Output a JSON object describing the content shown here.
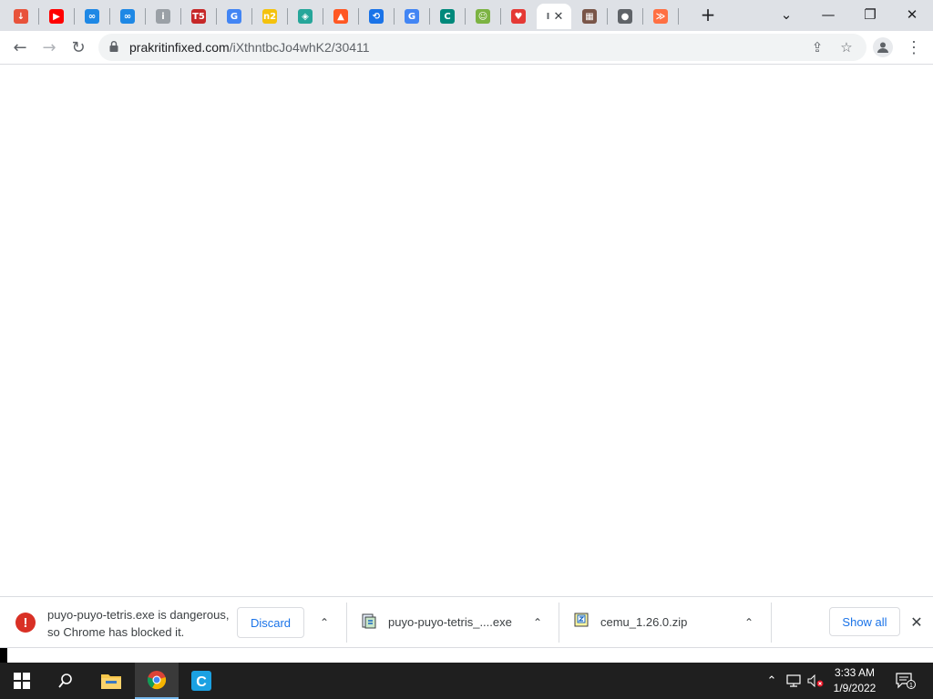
{
  "browser": {
    "tabs": [
      {
        "name": "download-tab",
        "icon": "download-icon",
        "color": "#e8533b",
        "glyph": "↓"
      },
      {
        "name": "youtube-tab",
        "icon": "youtube-icon",
        "color": "#ff0000",
        "glyph": "▶"
      },
      {
        "name": "link-tab-1",
        "icon": "link-icon",
        "color": "#1e88e5",
        "glyph": "∞"
      },
      {
        "name": "link-tab-2",
        "icon": "link-icon",
        "color": "#1e88e5",
        "glyph": "∞"
      },
      {
        "name": "info-tab",
        "icon": "info-icon",
        "color": "#9aa0a6",
        "glyph": "i"
      },
      {
        "name": "t5-tab",
        "icon": "t5-icon",
        "color": "#c62828",
        "glyph": "T5"
      },
      {
        "name": "google-tab-1",
        "icon": "google-icon",
        "color": "#4285f4",
        "glyph": "G"
      },
      {
        "name": "n2-tab",
        "icon": "n2-icon",
        "color": "#f4c20d",
        "glyph": "n2"
      },
      {
        "name": "cube-tab",
        "icon": "cube-icon",
        "color": "#26a69a",
        "glyph": "◈"
      },
      {
        "name": "warning-tab",
        "icon": "warning-icon",
        "color": "#ff5722",
        "glyph": "▲"
      },
      {
        "name": "history-tab",
        "icon": "history-icon",
        "color": "#1a73e8",
        "glyph": "⟲"
      },
      {
        "name": "google-tab-2",
        "icon": "google-icon",
        "color": "#4285f4",
        "glyph": "G"
      },
      {
        "name": "c-tab",
        "icon": "c-icon",
        "color": "#00897b",
        "glyph": "C"
      },
      {
        "name": "android-tab",
        "icon": "android-icon",
        "color": "#7cb342",
        "glyph": "☺"
      },
      {
        "name": "heart-tab",
        "icon": "heart-icon",
        "color": "#e53935",
        "glyph": "♥"
      },
      {
        "name": "active-tab",
        "icon": "page-icon",
        "color": "#5f6368",
        "glyph": "I",
        "active": true
      },
      {
        "name": "building-tab",
        "icon": "building-icon",
        "color": "#795548",
        "glyph": "▦"
      },
      {
        "name": "globe-tab",
        "icon": "globe-icon",
        "color": "#5f6368",
        "glyph": "●"
      },
      {
        "name": "chevrons-tab",
        "icon": "chevrons-icon",
        "color": "#ff7043",
        "glyph": "≫"
      }
    ],
    "url_host": "prakritinfixed.com",
    "url_path": "/iXthntbcJo4whK2/30411"
  },
  "downloads": {
    "warning_line1": "puyo-puyo-tetris.exe is dangerous,",
    "warning_line2": "so Chrome has blocked it.",
    "discard_label": "Discard",
    "file1": "puyo-puyo-tetris_....exe",
    "file2": "cemu_1.26.0.zip",
    "show_all_label": "Show all"
  },
  "taskbar": {
    "time": "3:33 AM",
    "date": "1/9/2022",
    "notification_count": "1"
  }
}
